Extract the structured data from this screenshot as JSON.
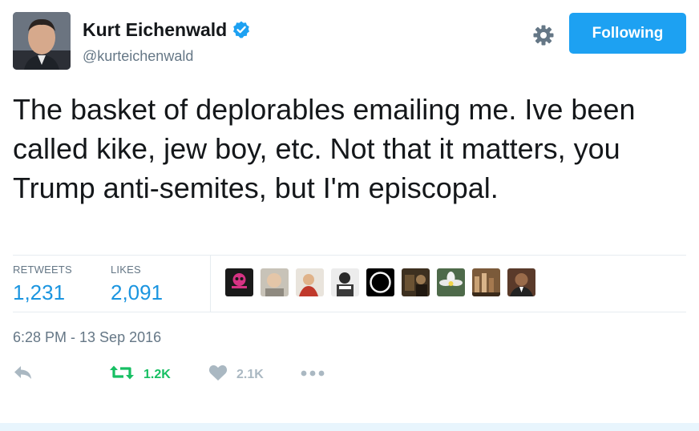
{
  "author": {
    "name": "Kurt Eichenwald",
    "handle": "@kurteichenwald",
    "verified": true,
    "icons": {
      "verified": "verified-badge-icon",
      "avatar": "avatar"
    }
  },
  "header": {
    "follow_label": "Following",
    "settings_icon": "gear-icon"
  },
  "tweet": {
    "text": "The basket of deplorables emailing me. Ive been called kike, jew boy, etc. Not that it matters, you Trump anti-semites, but I'm episcopal.",
    "timestamp": "6:28 PM - 13 Sep 2016"
  },
  "stats": {
    "retweets_label": "RETWEETS",
    "retweets_value": "1,231",
    "likes_label": "LIKES",
    "likes_value": "2,091",
    "liker_avatar_count": 9
  },
  "actions": {
    "reply_icon": "reply-icon",
    "retweet_icon": "retweet-icon",
    "retweet_count": "1.2K",
    "like_icon": "heart-icon",
    "like_count": "2.1K",
    "more_icon": "more-dots-icon"
  },
  "colors": {
    "brand_blue": "#1da1f2",
    "link_blue": "#1b95e0",
    "retweet_green": "#17bf63",
    "muted_gray": "#657786",
    "icon_gray": "#aab8c2"
  }
}
